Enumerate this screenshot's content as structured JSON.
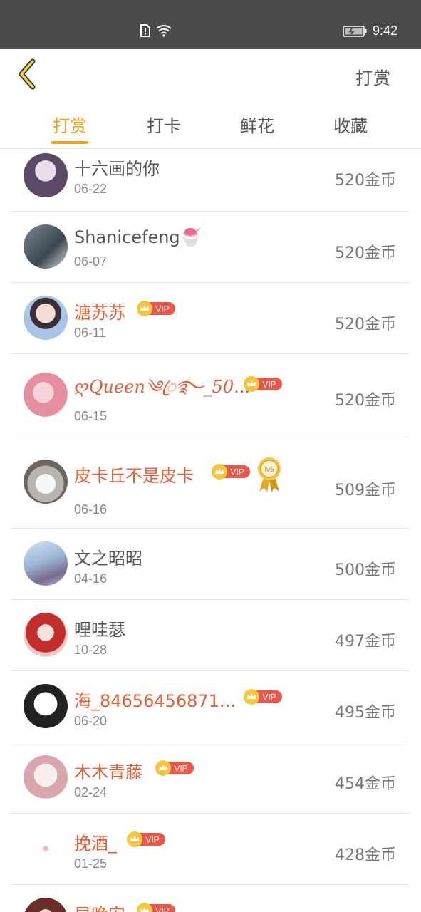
{
  "status_bar": {
    "time": "9:42"
  },
  "header": {
    "action_label": "打赏"
  },
  "tabs": [
    {
      "label": "打赏",
      "active": true
    },
    {
      "label": "打卡",
      "active": false
    },
    {
      "label": "鲜花",
      "active": false
    },
    {
      "label": "收藏",
      "active": false
    }
  ],
  "colors": {
    "accent": "#f0a020",
    "vip_name": "#e0603a",
    "vip_badge": "#e8574a"
  },
  "vip_badge_text": "VIP",
  "medal_text": "lv5",
  "rows": [
    {
      "name": "十六画的你",
      "date": "06-22",
      "amount": "520金币",
      "vip": false
    },
    {
      "name": "Shanicefeng🍧",
      "date": "06-07",
      "amount": "520金币",
      "vip": false
    },
    {
      "name": "溏苏苏",
      "date": "06-11",
      "amount": "520金币",
      "vip": true
    },
    {
      "name": "ღQueen༄ꦿ࿐_50...",
      "date": "06-15",
      "amount": "520金币",
      "vip": true
    },
    {
      "name": "皮卡丘不是皮卡",
      "date": "06-16",
      "amount": "509金币",
      "vip": true,
      "medal": true
    },
    {
      "name": "文之昭昭",
      "date": "04-16",
      "amount": "500金币",
      "vip": false
    },
    {
      "name": "哩哇瑟",
      "date": "10-28",
      "amount": "497金币",
      "vip": false
    },
    {
      "name": "海_84656456871...",
      "date": "06-20",
      "amount": "495金币",
      "vip": true
    },
    {
      "name": "木木青藤",
      "date": "02-24",
      "amount": "454金币",
      "vip": true
    },
    {
      "name": "挽酒_",
      "date": "01-25",
      "amount": "428金币",
      "vip": true
    },
    {
      "name": "早晚安",
      "date": "",
      "amount": "",
      "vip": true
    }
  ]
}
